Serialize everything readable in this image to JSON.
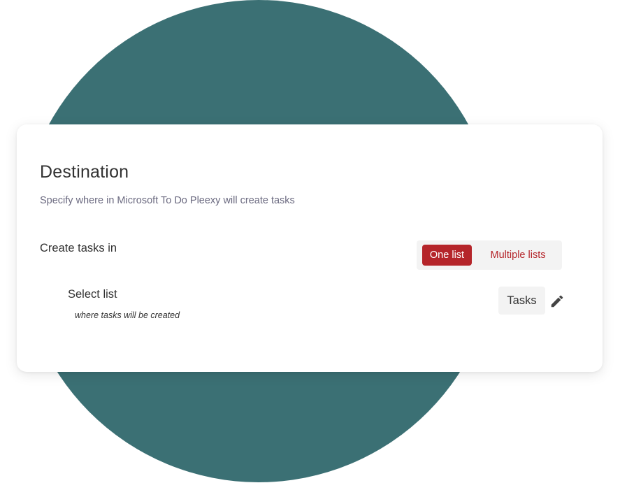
{
  "card": {
    "title": "Destination",
    "subtitle": "Specify where in Microsoft To Do Pleexy will create tasks"
  },
  "create_tasks_in": {
    "label": "Create tasks in",
    "options": [
      {
        "label": "One list",
        "selected": true
      },
      {
        "label": "Multiple lists",
        "selected": false
      }
    ]
  },
  "select_list": {
    "label": "Select list",
    "hint": "where tasks will be created",
    "value": "Tasks",
    "edit_icon": "pencil-icon"
  },
  "colors": {
    "background_circle": "#3b7074",
    "accent": "#b5252a",
    "pill_background": "#f3f3f3",
    "text_primary": "#333333",
    "text_secondary": "#6b6a80"
  }
}
